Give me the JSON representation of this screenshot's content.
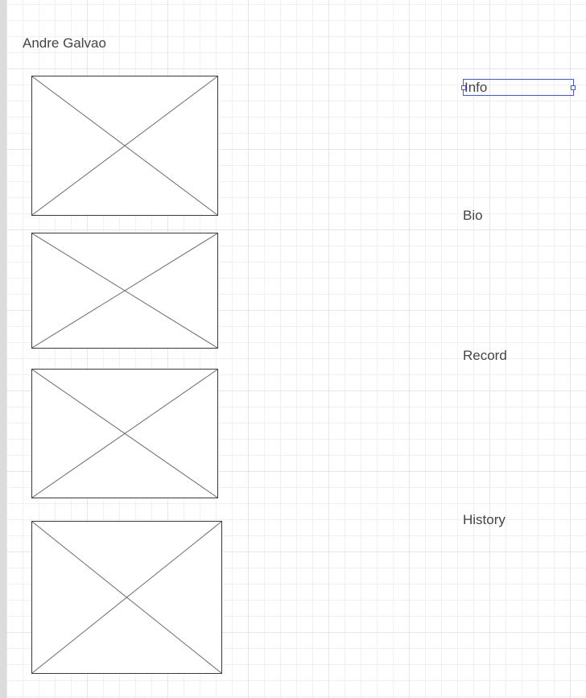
{
  "page": {
    "title": "Andre Galvao"
  },
  "images": [
    {
      "name": "image-placeholder-1"
    },
    {
      "name": "image-placeholder-2"
    },
    {
      "name": "image-placeholder-3"
    },
    {
      "name": "image-placeholder-4"
    }
  ],
  "nav": {
    "info": "Info",
    "bio": "Bio",
    "record": "Record",
    "history": "History"
  },
  "colors": {
    "selection": "#4a5ad0",
    "text": "#444444",
    "grid": "#e6e6e6"
  }
}
